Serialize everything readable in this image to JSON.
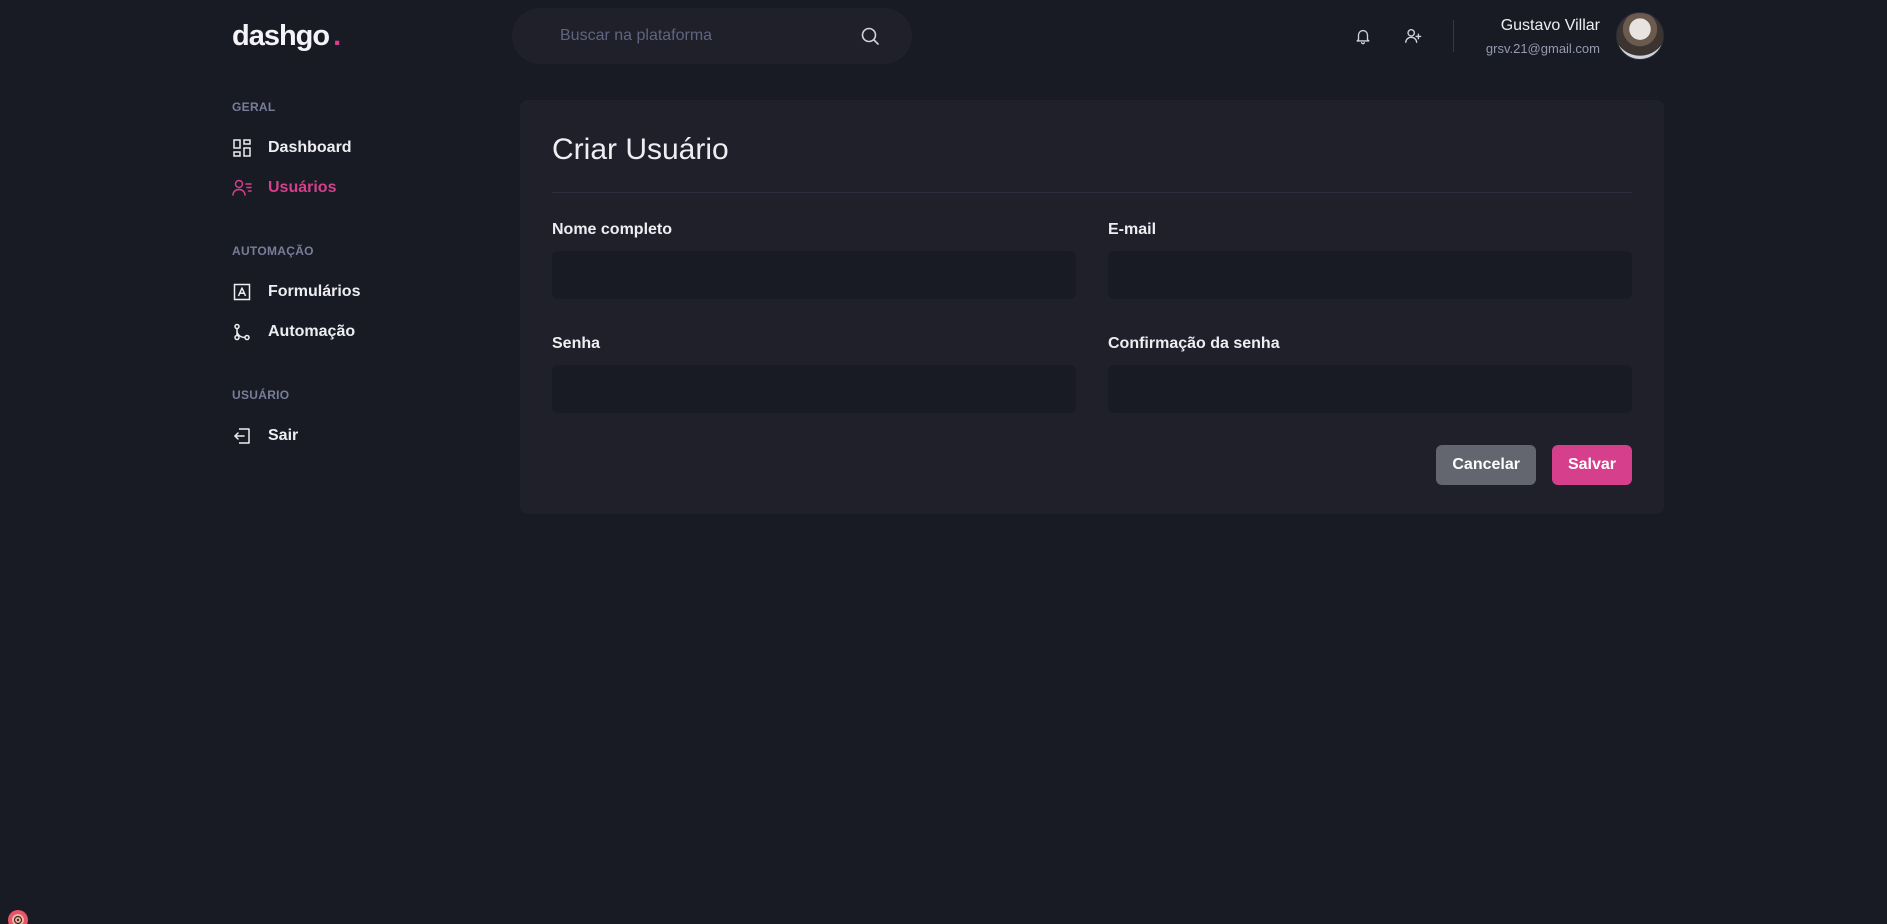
{
  "brand": {
    "name": "dashgo",
    "dot": ".",
    "accent": "#d53f8c"
  },
  "search": {
    "placeholder": "Buscar na plataforma"
  },
  "header": {
    "notifications_icon": "bell-icon",
    "add_user_icon": "user-add-icon",
    "user": {
      "name": "Gustavo Villar",
      "email": "grsv.21@gmail.com"
    }
  },
  "sidebar": {
    "sections": [
      {
        "title": "GERAL",
        "items": [
          {
            "label": "Dashboard",
            "icon": "dashboard-icon",
            "active": false
          },
          {
            "label": "Usuários",
            "icon": "users-icon",
            "active": true
          }
        ]
      },
      {
        "title": "AUTOMAÇÃO",
        "items": [
          {
            "label": "Formulários",
            "icon": "form-icon",
            "active": false
          },
          {
            "label": "Automação",
            "icon": "git-merge-icon",
            "active": false
          }
        ]
      },
      {
        "title": "USUÁRIO",
        "items": [
          {
            "label": "Sair",
            "icon": "logout-icon",
            "active": false
          }
        ]
      }
    ]
  },
  "form": {
    "title": "Criar Usuário",
    "fields": {
      "name": {
        "label": "Nome completo",
        "value": ""
      },
      "email": {
        "label": "E-mail",
        "value": ""
      },
      "password": {
        "label": "Senha",
        "value": ""
      },
      "password_confirmation": {
        "label": "Confirmação da senha",
        "value": ""
      }
    },
    "cancel_label": "Cancelar",
    "save_label": "Salvar"
  }
}
